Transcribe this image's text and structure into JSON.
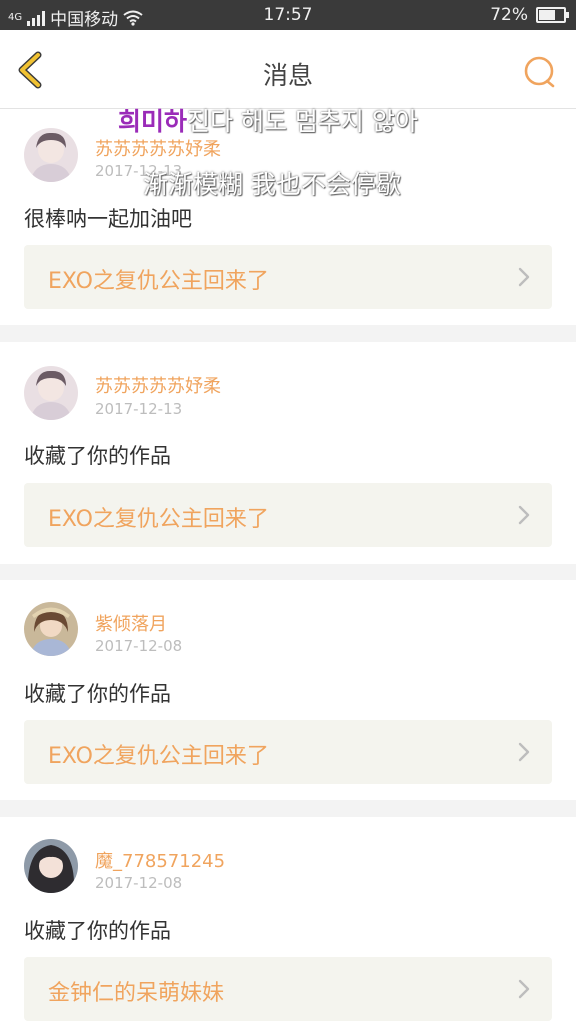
{
  "status_bar": {
    "network": "4G",
    "carrier": "中国移动",
    "time": "17:57",
    "battery": "72%",
    "battery_level": 0.72
  },
  "nav": {
    "title": "消息",
    "back_icon": "chevron-left-icon",
    "search_icon": "search-icon"
  },
  "lyrics": {
    "line1_highlight": "희미하",
    "line1_rest": "진다 해도 멈추지 않아",
    "line2": "渐渐模糊 我也不会停歇"
  },
  "messages": [
    {
      "user": "苏苏苏苏苏妤柔",
      "date": "2017-12-13",
      "text": "很棒呐一起加油吧",
      "work": "EXO之复仇公主回来了"
    },
    {
      "user": "苏苏苏苏苏妤柔",
      "date": "2017-12-13",
      "text": "收藏了你的作品",
      "work": "EXO之复仇公主回来了"
    },
    {
      "user": "紫倾落月",
      "date": "2017-12-08",
      "text": "收藏了你的作品",
      "work": "EXO之复仇公主回来了"
    },
    {
      "user": "魔_778571245",
      "date": "2017-12-08",
      "text": "收藏了你的作品",
      "work": "金钟仁的呆萌妹妹"
    }
  ],
  "colors": {
    "accent": "#f0a45e",
    "back_icon": "#f1c232",
    "status_bar_bg": "#3a3a3a",
    "card_work_bg": "#f4f4ee",
    "lyric_highlight": "#9a2bb8"
  }
}
